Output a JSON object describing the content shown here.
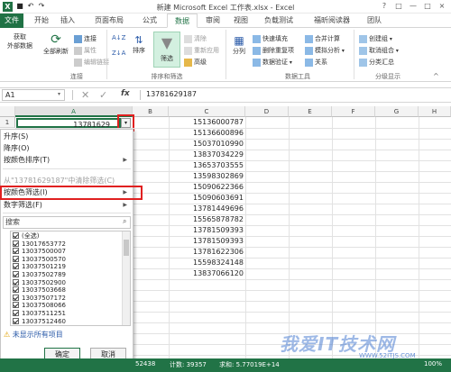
{
  "window": {
    "title": "新建 Microsoft Excel 工作表.xlsx - Excel",
    "qa_icons": [
      "save-icon",
      "undo-icon",
      "redo-icon"
    ],
    "controls": [
      "?",
      "□",
      "—",
      "□",
      "×"
    ]
  },
  "tabs": [
    "文件",
    "开始",
    "插入",
    "页面布局",
    "公式",
    "数据",
    "审阅",
    "视图",
    "负载测试",
    "福昕阅读器",
    "团队"
  ],
  "active_tab": "数据",
  "ribbon": {
    "get_external": "获取\n外部数据",
    "refresh_all": "全部刷新",
    "connections": [
      "连接",
      "属性",
      "编辑链接"
    ],
    "sort_az": "A↓Z",
    "sort_za": "Z↓A",
    "sort": "排序",
    "filter": "筛选",
    "filter_opts": [
      "清除",
      "重新应用",
      "高级"
    ],
    "split": "分列",
    "data_tools": [
      "快速填充",
      "删除重复项",
      "数据验证"
    ],
    "data_tools2": [
      "合并计算",
      "模拟分析",
      "关系"
    ],
    "outline": [
      "创建组",
      "取消组合",
      "分类汇总"
    ],
    "group_labels": [
      "连接",
      "排序和筛选",
      "数据工具",
      "分级显示"
    ]
  },
  "formula_bar": {
    "name_box": "A1",
    "formula": "13781629187",
    "fx": "fx"
  },
  "columns": [
    "A",
    "B",
    "C",
    "D",
    "E",
    "F",
    "G",
    "H"
  ],
  "active_col": "A",
  "row1": {
    "num": "1",
    "a1": "13781629"
  },
  "column_c": [
    "15136000787",
    "15136600896",
    "15037010990",
    "13837034229",
    "13653703555",
    "13598302869",
    "15090622366",
    "15090603691",
    "13781449696",
    "15565878782",
    "13781509393",
    "13781509393",
    "13781622306",
    "15598324148",
    "13837066120"
  ],
  "menu": {
    "items": [
      {
        "label": "升序(S)",
        "dis": false,
        "sub": false
      },
      {
        "label": "降序(O)",
        "dis": false,
        "sub": false
      },
      {
        "label": "按颜色排序(T)",
        "dis": false,
        "sub": true
      },
      {
        "label": "从\"13781629187\"中清除筛选(C)",
        "dis": true,
        "sub": false
      },
      {
        "label": "按颜色筛选(I)",
        "dis": false,
        "sub": true
      },
      {
        "label": "数字筛选(F)",
        "dis": false,
        "sub": true
      }
    ],
    "search_placeholder": "搜索",
    "list": [
      "(全选)",
      "13017653772",
      "13037500007",
      "13037500570",
      "13037501219",
      "13037502789",
      "13037502900",
      "13037503668",
      "13037507172",
      "13037508066",
      "13037511251",
      "13037512460"
    ],
    "warning": "未显示所有项目",
    "ok": "确定",
    "cancel": "取消"
  },
  "status": {
    "avg": "52438",
    "count": "计数: 39357",
    "sum": "求和: 5.77019E+14",
    "zoom": "100%"
  },
  "watermark": {
    "text": "我爱IT技术网",
    "url": "WWW.52ITJS.COM"
  },
  "colors": {
    "excel_green": "#217346",
    "highlight": "#e02020"
  }
}
